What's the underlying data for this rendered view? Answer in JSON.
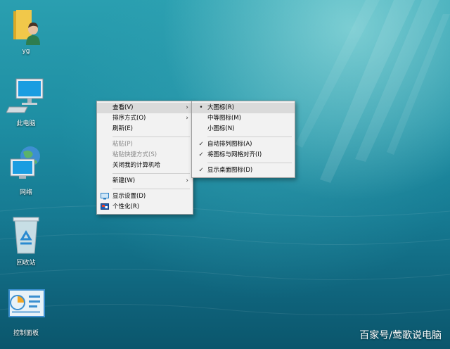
{
  "desktop": {
    "icons": [
      {
        "label": "yg"
      },
      {
        "label": "此电脑"
      },
      {
        "label": "网络"
      },
      {
        "label": "回收站"
      },
      {
        "label": "控制面板"
      }
    ]
  },
  "context_menu": {
    "items": [
      {
        "label": "查看(V)"
      },
      {
        "label": "排序方式(O)"
      },
      {
        "label": "刷新(E)"
      },
      {
        "label": "粘贴(P)"
      },
      {
        "label": "粘贴快捷方式(S)"
      },
      {
        "label": "关闭我的计算机哈"
      },
      {
        "label": "新建(W)"
      },
      {
        "label": "显示设置(D)"
      },
      {
        "label": "个性化(R)"
      }
    ]
  },
  "view_submenu": {
    "items": [
      {
        "label": "大图标(R)"
      },
      {
        "label": "中等图标(M)"
      },
      {
        "label": "小图标(N)"
      },
      {
        "label": "自动排列图标(A)"
      },
      {
        "label": "将图标与网格对齐(I)"
      },
      {
        "label": "显示桌面图标(D)"
      }
    ]
  },
  "watermark": "百家号/莺歌说电脑"
}
